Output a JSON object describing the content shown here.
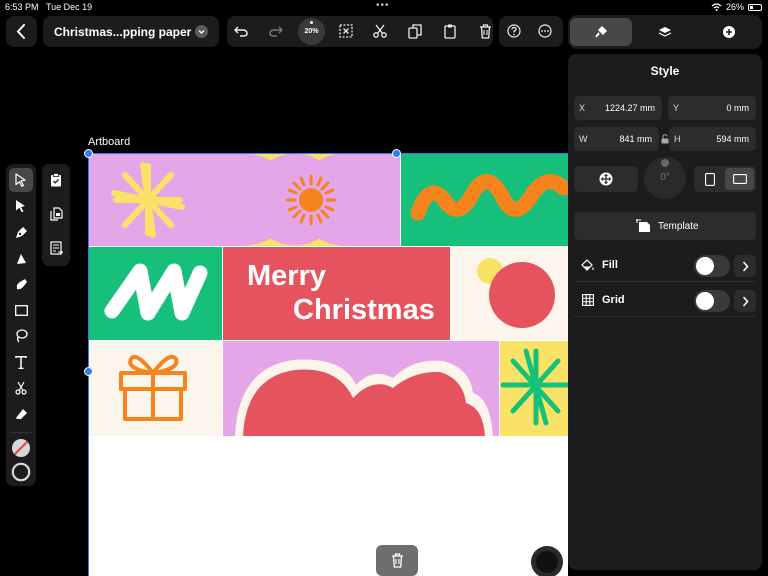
{
  "status": {
    "time": "6:53 PM",
    "date": "Tue Dec 19",
    "battery": "26%"
  },
  "document": {
    "title": "Christmas...pping paper"
  },
  "toolbar": {
    "zoom": "20%"
  },
  "panel": {
    "title": "Style",
    "x_label": "X",
    "x_value": "1224.27 mm",
    "y_label": "Y",
    "y_value": "0 mm",
    "w_label": "W",
    "w_value": "841 mm",
    "h_label": "H",
    "h_value": "594 mm",
    "rotation": "0°",
    "template_label": "Template",
    "fill_label": "Fill",
    "grid_label": "Grid",
    "fill_on": false,
    "grid_on": false
  },
  "artboard": {
    "label": "Artboard",
    "headline_1": "Merry",
    "headline_2": "Christmas"
  },
  "colors": {
    "pink": "#e4a6e8",
    "yellow": "#fae267",
    "green": "#16c07a",
    "orange": "#f7831c",
    "red": "#e5545e",
    "cream": "#fbf5ec",
    "accent": "#2f7cf6"
  }
}
